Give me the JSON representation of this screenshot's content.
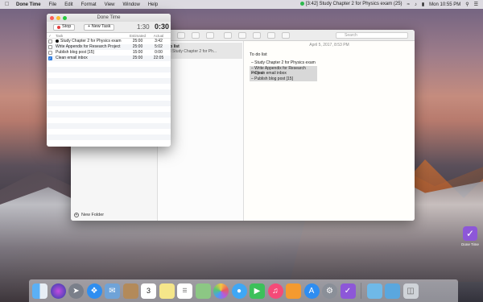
{
  "menubar": {
    "app": "Done Time",
    "items": [
      "File",
      "Edit",
      "Format",
      "View",
      "Window",
      "Help"
    ],
    "status": "[3:42] Study Chapter 2 for Physics exam (25)",
    "datetime": "Mon 10:55 PM"
  },
  "notes_window": {
    "search_placeholder": "Search",
    "note_card_title": "To do list",
    "note_card_sub": "5:PM  Study Chapter 2 for Ph...",
    "date": "April 5, 2017, 8:53 PM",
    "title": "To do list",
    "lines": [
      "Study Chapter 2 for Physics exam",
      "Write Appendix for Research Project",
      "Clean email inbox",
      "Publish blog post [15]"
    ],
    "new_folder": "New Folder"
  },
  "done_time": {
    "window_title": "Done Time",
    "stop_label": "Stop",
    "new_task_label": "+ New Task",
    "time_elapsed": "1:30",
    "time_remaining": "0:30",
    "headers": {
      "check": "✓",
      "task": "Task",
      "estimated": "Estimated",
      "actual": "Actual"
    },
    "tasks": [
      {
        "task": "Study Chapter 2 for Physics exam",
        "estimated": "25:00",
        "actual": "3:42",
        "done": false,
        "active": true
      },
      {
        "task": "Write Appendix for Research Project",
        "estimated": "25:00",
        "actual": "5:02",
        "done": false,
        "active": false
      },
      {
        "task": "Publish blog post [15]",
        "estimated": "15:00",
        "actual": "0:00",
        "done": false,
        "active": false
      },
      {
        "task": "Clean email inbox",
        "estimated": "25:00",
        "actual": "22:05",
        "done": true,
        "active": false
      }
    ]
  },
  "desktop_icon": {
    "label": "Done Time"
  },
  "dock": {
    "icons": [
      "finder-icon",
      "siri-icon",
      "launchpad-icon",
      "safari-icon",
      "mail-icon",
      "contacts-icon",
      "calendar-icon",
      "notes-icon",
      "reminders-icon",
      "maps-icon",
      "photos-icon",
      "messages-icon",
      "facetime-icon",
      "itunes-icon",
      "ibooks-icon",
      "app-store-icon",
      "system-preferences-icon",
      "done-time-icon",
      "downloads-icon",
      "documents-icon",
      "trash-icon"
    ],
    "calendar_day": "3"
  },
  "colors": {
    "accent": "#2f7de1",
    "stop": "#e33b3b",
    "done_time_brand": "#8d57d8"
  }
}
